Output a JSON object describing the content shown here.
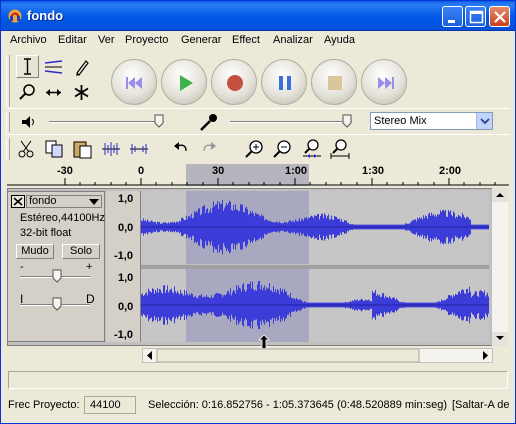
{
  "window": {
    "title": "fondo",
    "accent": "#0058e6"
  },
  "menu": [
    "Archivo",
    "Editar",
    "Ver",
    "Proyecto",
    "Generar",
    "Effect",
    "Analizar",
    "Ayuda"
  ],
  "tools": [
    "select-tool-icon",
    "envelope-tool-icon",
    "draw-tool-icon",
    "zoom-tool-icon",
    "timeshift-tool-icon",
    "multi-tool-icon"
  ],
  "transport": [
    "skip-start",
    "play",
    "record",
    "pause",
    "stop",
    "skip-end"
  ],
  "mixer": {
    "input_source": "Stereo Mix"
  },
  "ruler": {
    "ticks": [
      "-30",
      "0",
      "30",
      "1:00",
      "1:30",
      "2:00"
    ]
  },
  "track": {
    "name": "fondo",
    "rate": "Estéreo,44100Hz",
    "format": "32-bit float",
    "mute": "Mudo",
    "solo": "Solo",
    "gain_minus": "-",
    "gain_plus": "+",
    "pan_left": "I",
    "pan_right": "D",
    "scale": [
      "1,0",
      "0,0",
      "-1,0"
    ]
  },
  "status": {
    "rate_label": "Frec Proyecto:",
    "rate_value": "44100",
    "selection": "Selección: 0:16.852756 - 1:05.373645 (0:48.520889 min:seg)",
    "snap": "[Saltar-A de"
  }
}
